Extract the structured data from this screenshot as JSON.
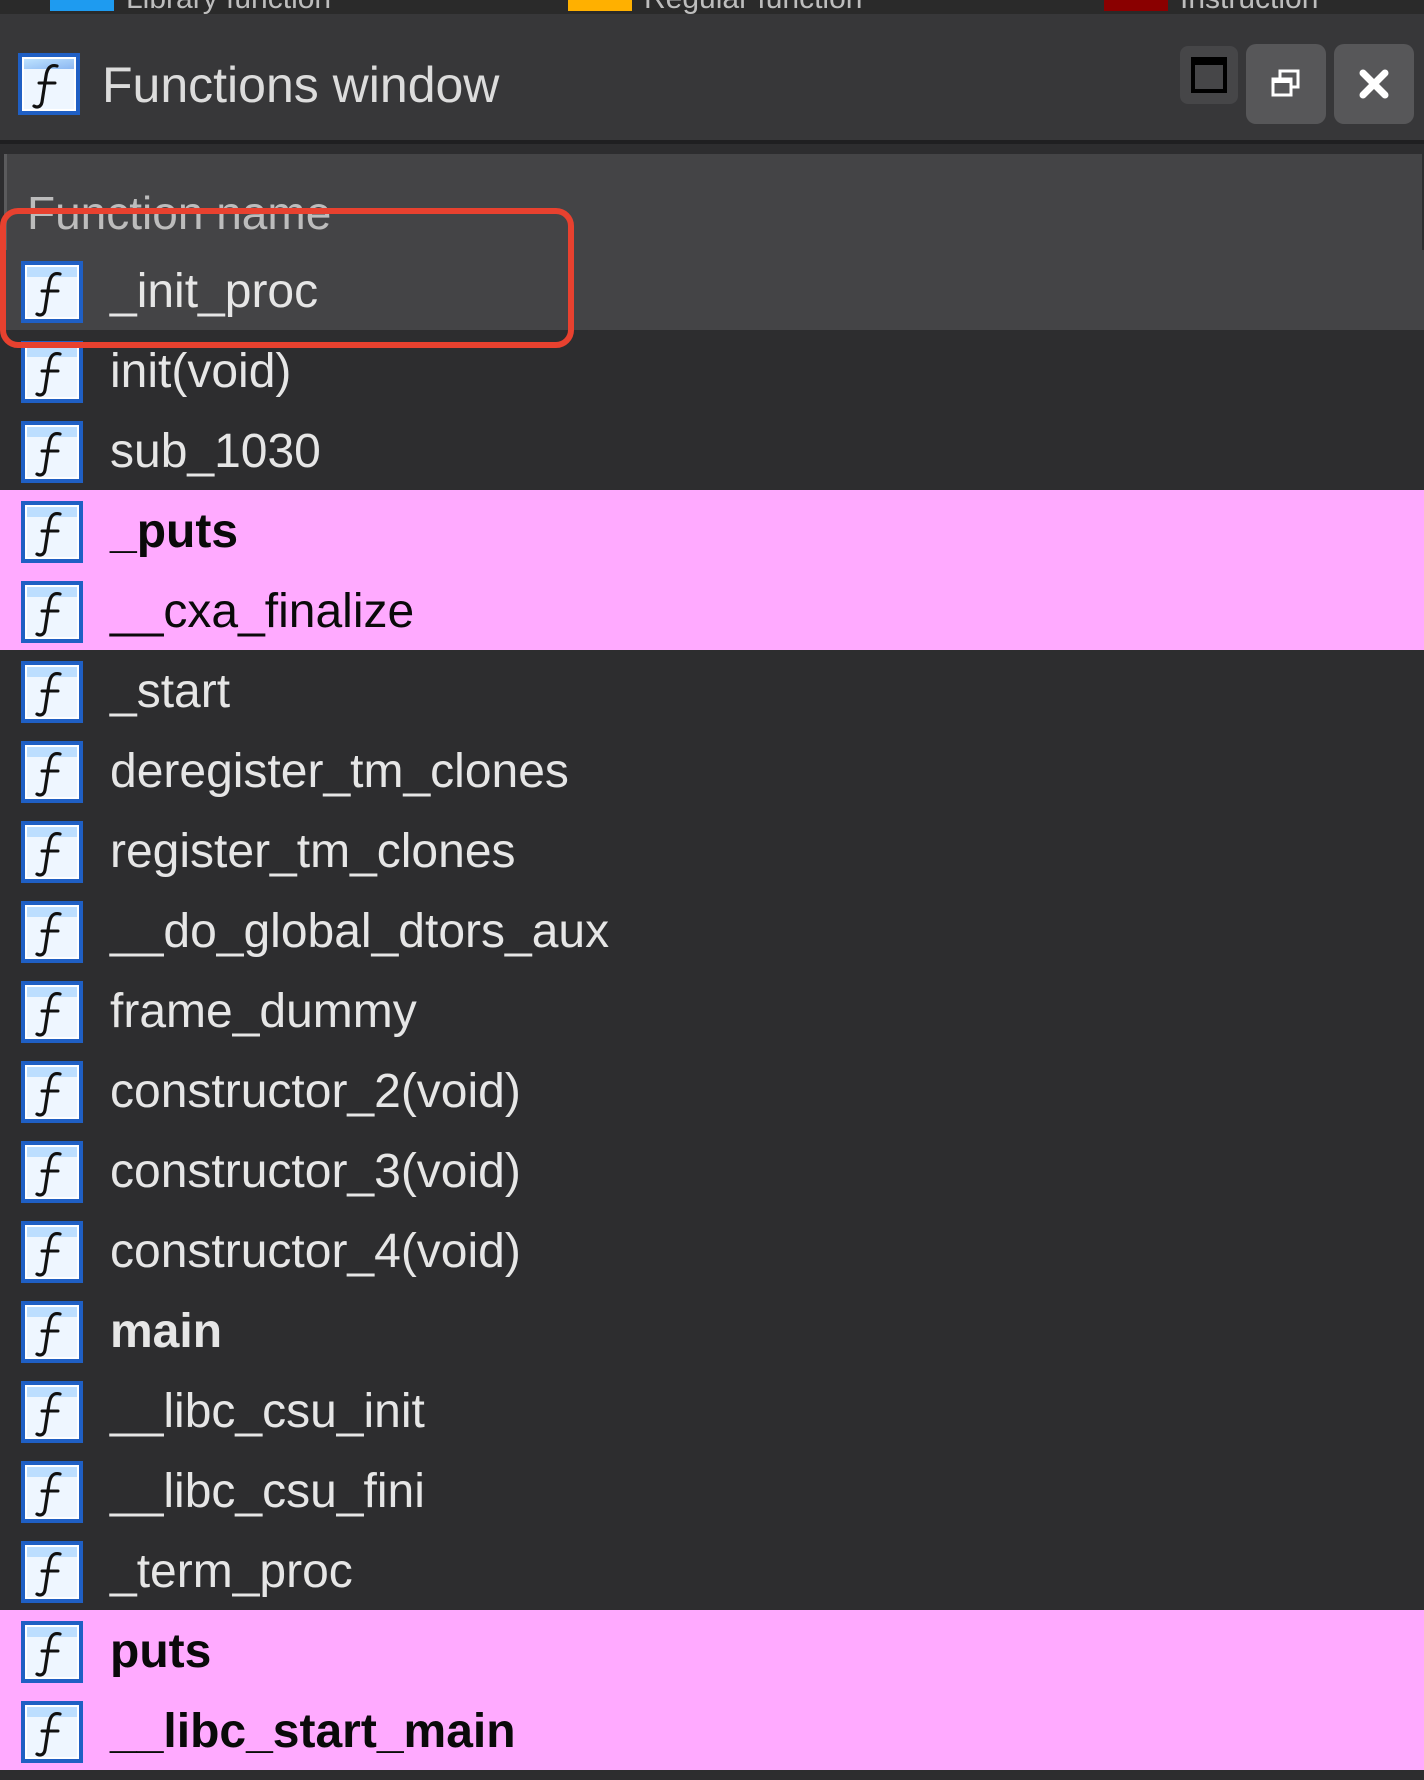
{
  "top_strip": {
    "legend": [
      {
        "label": "Library function",
        "color": "#1e9bf0"
      },
      {
        "label": "Regular function",
        "color": "#ffb000"
      },
      {
        "label": "Instruction",
        "color": "#8a0000"
      }
    ]
  },
  "window": {
    "title": "Functions window",
    "icon": "function-icon",
    "buttons": {
      "maximize": "maximize-icon",
      "restore": "restore-icon",
      "close": "close-icon"
    }
  },
  "table": {
    "column_header": "Function name",
    "rows": [
      {
        "name": "_init_proc",
        "state": "selected",
        "bold": false
      },
      {
        "name": "init(void)",
        "state": "normal",
        "bold": false
      },
      {
        "name": "sub_1030",
        "state": "normal",
        "bold": false
      },
      {
        "name": "_puts",
        "state": "highlighted",
        "bold": true
      },
      {
        "name": "__cxa_finalize",
        "state": "highlighted",
        "bold": false
      },
      {
        "name": "_start",
        "state": "normal",
        "bold": false
      },
      {
        "name": "deregister_tm_clones",
        "state": "normal",
        "bold": false
      },
      {
        "name": "register_tm_clones",
        "state": "normal",
        "bold": false
      },
      {
        "name": "__do_global_dtors_aux",
        "state": "normal",
        "bold": false
      },
      {
        "name": "frame_dummy",
        "state": "normal",
        "bold": false
      },
      {
        "name": "constructor_2(void)",
        "state": "normal",
        "bold": false
      },
      {
        "name": "constructor_3(void)",
        "state": "normal",
        "bold": false
      },
      {
        "name": "constructor_4(void)",
        "state": "normal",
        "bold": false
      },
      {
        "name": "main",
        "state": "normal",
        "bold": true
      },
      {
        "name": "__libc_csu_init",
        "state": "normal",
        "bold": false
      },
      {
        "name": "__libc_csu_fini",
        "state": "normal",
        "bold": false
      },
      {
        "name": "_term_proc",
        "state": "normal",
        "bold": false
      },
      {
        "name": "puts",
        "state": "highlighted",
        "bold": true
      },
      {
        "name": "__libc_start_main",
        "state": "highlighted",
        "bold": true
      }
    ]
  },
  "colors": {
    "selected_row": "#444446",
    "highlight_row": "#ffaaff",
    "annotation": "#e8412f",
    "background": "#2d2d2f"
  }
}
